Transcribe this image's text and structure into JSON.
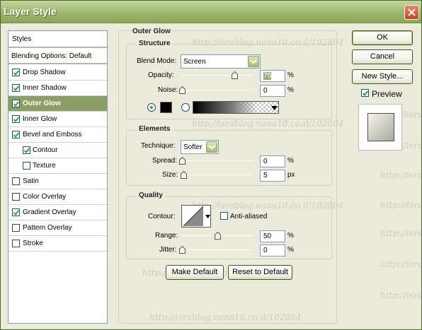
{
  "window": {
    "title": "Layer Style"
  },
  "sidebar": {
    "header": "Styles",
    "blending": "Blending Options: Default",
    "items": [
      {
        "label": "Drop Shadow",
        "checked": true
      },
      {
        "label": "Inner Shadow",
        "checked": true
      },
      {
        "label": "Outer Glow",
        "checked": true,
        "selected": true
      },
      {
        "label": "Inner Glow",
        "checked": true
      },
      {
        "label": "Bevel and Emboss",
        "checked": true
      },
      {
        "label": "Contour",
        "checked": true,
        "indent": true
      },
      {
        "label": "Texture",
        "checked": false,
        "indent": true
      },
      {
        "label": "Satin",
        "checked": false
      },
      {
        "label": "Color Overlay",
        "checked": false
      },
      {
        "label": "Gradient Overlay",
        "checked": true
      },
      {
        "label": "Pattern Overlay",
        "checked": false
      },
      {
        "label": "Stroke",
        "checked": false
      }
    ]
  },
  "outer_glow": {
    "title": "Outer Glow",
    "structure": {
      "title": "Structure",
      "blend_mode_label": "Blend Mode:",
      "blend_mode_value": "Screen",
      "opacity_label": "Opacity:",
      "opacity_value": "75",
      "opacity_level": 0.75,
      "noise_label": "Noise:",
      "noise_value": "0",
      "noise_level": 0,
      "percent": "%",
      "color": "#000000"
    },
    "elements": {
      "title": "Elements",
      "technique_label": "Technique:",
      "technique_value": "Softer",
      "spread_label": "Spread:",
      "spread_value": "0",
      "spread_level": 0,
      "size_label": "Size:",
      "size_value": "5",
      "size_level": 0.02,
      "percent": "%",
      "px": "px"
    },
    "quality": {
      "title": "Quality",
      "contour_label": "Contour:",
      "anti_aliased_label": "Anti-aliased",
      "anti_aliased_checked": false,
      "range_label": "Range:",
      "range_value": "50",
      "range_level": 0.5,
      "jitter_label": "Jitter:",
      "jitter_value": "0",
      "jitter_level": 0,
      "percent": "%"
    },
    "make_default": "Make Default",
    "reset_default": "Reset to Default"
  },
  "buttons": {
    "ok": "OK",
    "cancel": "Cancel",
    "new_style": "New Style..."
  },
  "preview": {
    "label": "Preview",
    "checked": true
  },
  "watermark": "http://israblog.nana10.co.il/102804",
  "colors": {
    "title_bar": "#9db66b",
    "selected_row": "#8b9e63",
    "dialog_bg": "#ebeadb"
  }
}
